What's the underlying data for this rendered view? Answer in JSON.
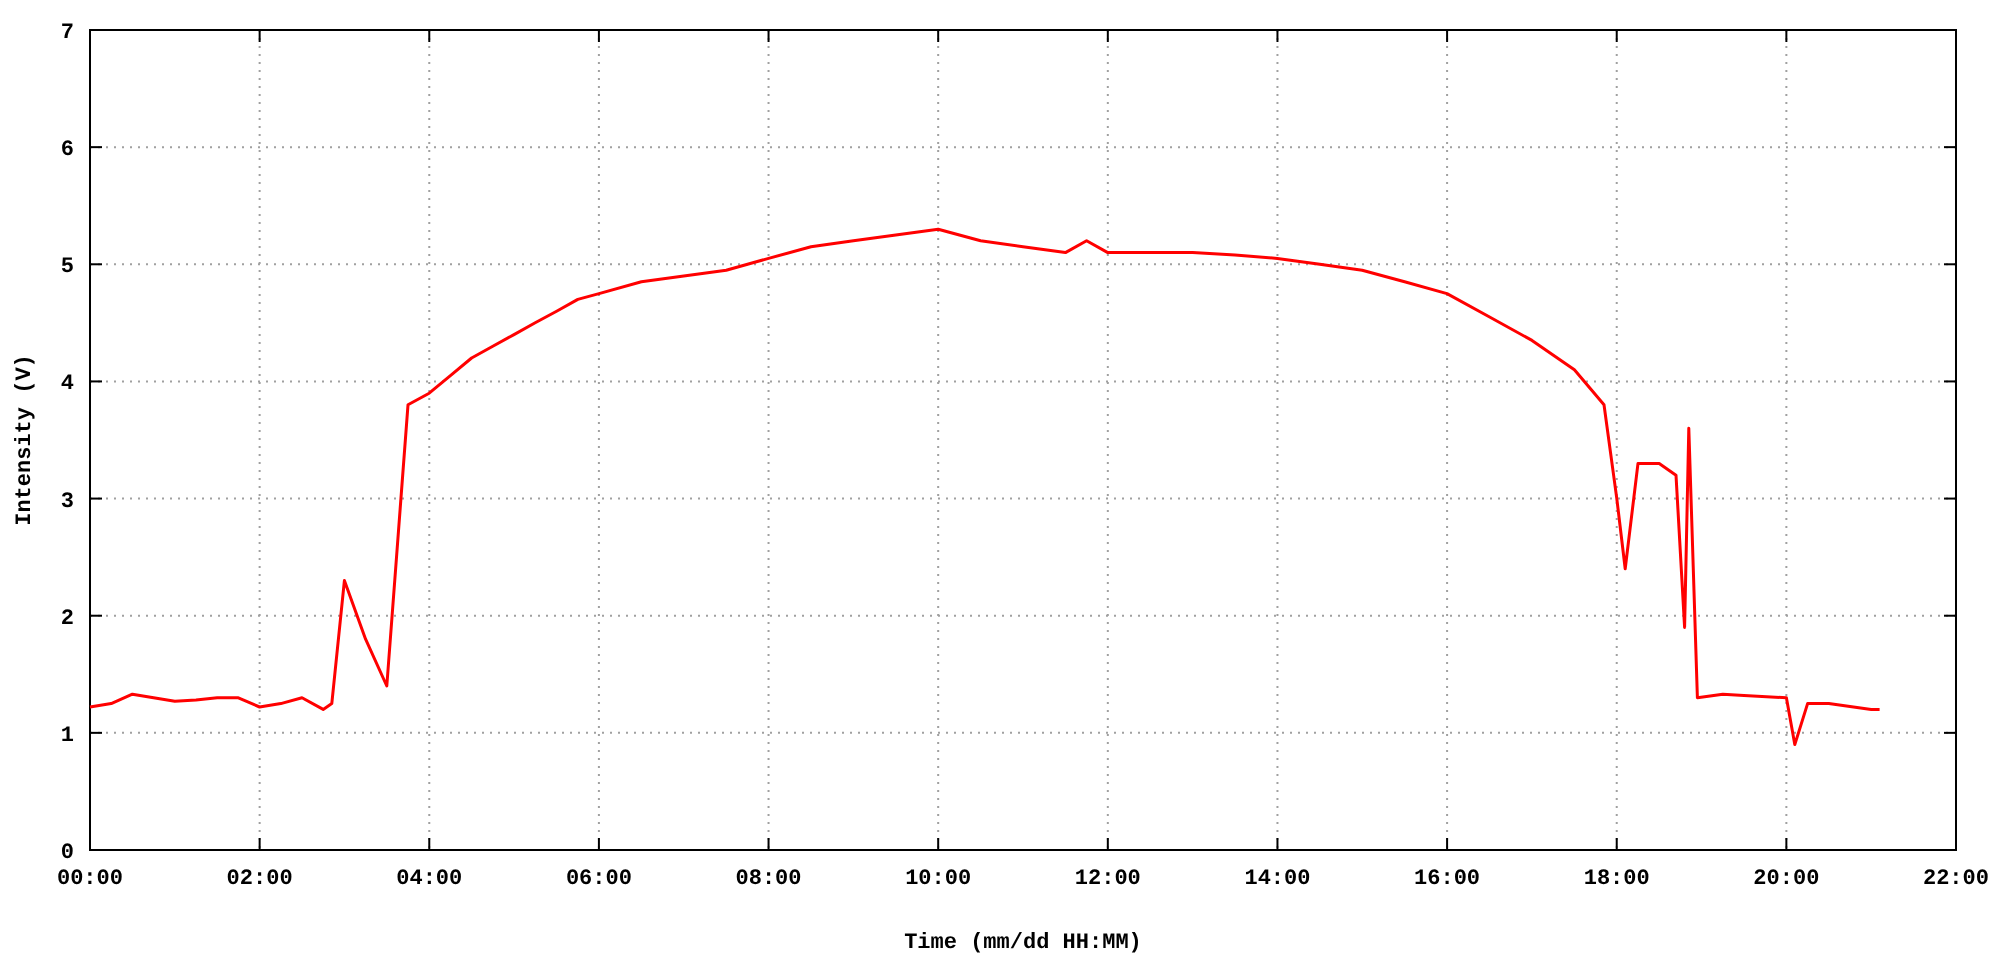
{
  "chart_data": {
    "type": "line",
    "xlabel": "Time (mm/dd HH:MM)",
    "ylabel": "Intensity (V)",
    "x": [
      0,
      0.25,
      0.5,
      0.75,
      1,
      1.25,
      1.5,
      1.75,
      2,
      2.25,
      2.5,
      2.75,
      2.85,
      3,
      3.25,
      3.5,
      3.75,
      4,
      4.25,
      4.5,
      4.75,
      5,
      5.25,
      5.5,
      5.75,
      6,
      6.5,
      7,
      7.5,
      8,
      8.5,
      9,
      9.5,
      10,
      10.5,
      11,
      11.5,
      11.75,
      12,
      12.5,
      13,
      13.5,
      14,
      14.5,
      15,
      15.5,
      16,
      16.5,
      17,
      17.5,
      17.85,
      18,
      18.1,
      18.25,
      18.5,
      18.7,
      18.8,
      18.85,
      18.95,
      19.25,
      19.5,
      20,
      20.1,
      20.25,
      20.5,
      21,
      21.1
    ],
    "grid": true,
    "series": [
      {
        "color": "#ff0000",
        "values": [
          1.22,
          1.25,
          1.33,
          1.3,
          1.27,
          1.28,
          1.3,
          1.3,
          1.22,
          1.25,
          1.3,
          1.2,
          1.25,
          2.3,
          1.8,
          1.4,
          3.8,
          3.9,
          4.05,
          4.2,
          4.3,
          4.4,
          4.5,
          4.6,
          4.7,
          4.75,
          4.85,
          4.9,
          4.95,
          5.05,
          5.15,
          5.2,
          5.25,
          5.3,
          5.2,
          5.15,
          5.1,
          5.2,
          5.1,
          5.1,
          5.1,
          5.08,
          5.05,
          5.0,
          4.95,
          4.85,
          4.75,
          4.55,
          4.35,
          4.1,
          3.8,
          3.0,
          2.4,
          3.3,
          3.3,
          3.2,
          1.9,
          3.6,
          1.3,
          1.33,
          1.32,
          1.3,
          0.9,
          1.25,
          1.25,
          1.2,
          1.2
        ]
      }
    ],
    "xlim": [
      0,
      22
    ],
    "ylim": [
      0,
      7
    ],
    "xticks": [
      {
        "value": 0,
        "label": "00:00"
      },
      {
        "value": 2,
        "label": "02:00"
      },
      {
        "value": 4,
        "label": "04:00"
      },
      {
        "value": 6,
        "label": "06:00"
      },
      {
        "value": 8,
        "label": "08:00"
      },
      {
        "value": 10,
        "label": "10:00"
      },
      {
        "value": 12,
        "label": "12:00"
      },
      {
        "value": 14,
        "label": "14:00"
      },
      {
        "value": 16,
        "label": "16:00"
      },
      {
        "value": 18,
        "label": "18:00"
      },
      {
        "value": 20,
        "label": "20:00"
      },
      {
        "value": 22,
        "label": "22:00"
      }
    ],
    "yticks": [
      0,
      1,
      2,
      3,
      4,
      5,
      6,
      7
    ]
  }
}
